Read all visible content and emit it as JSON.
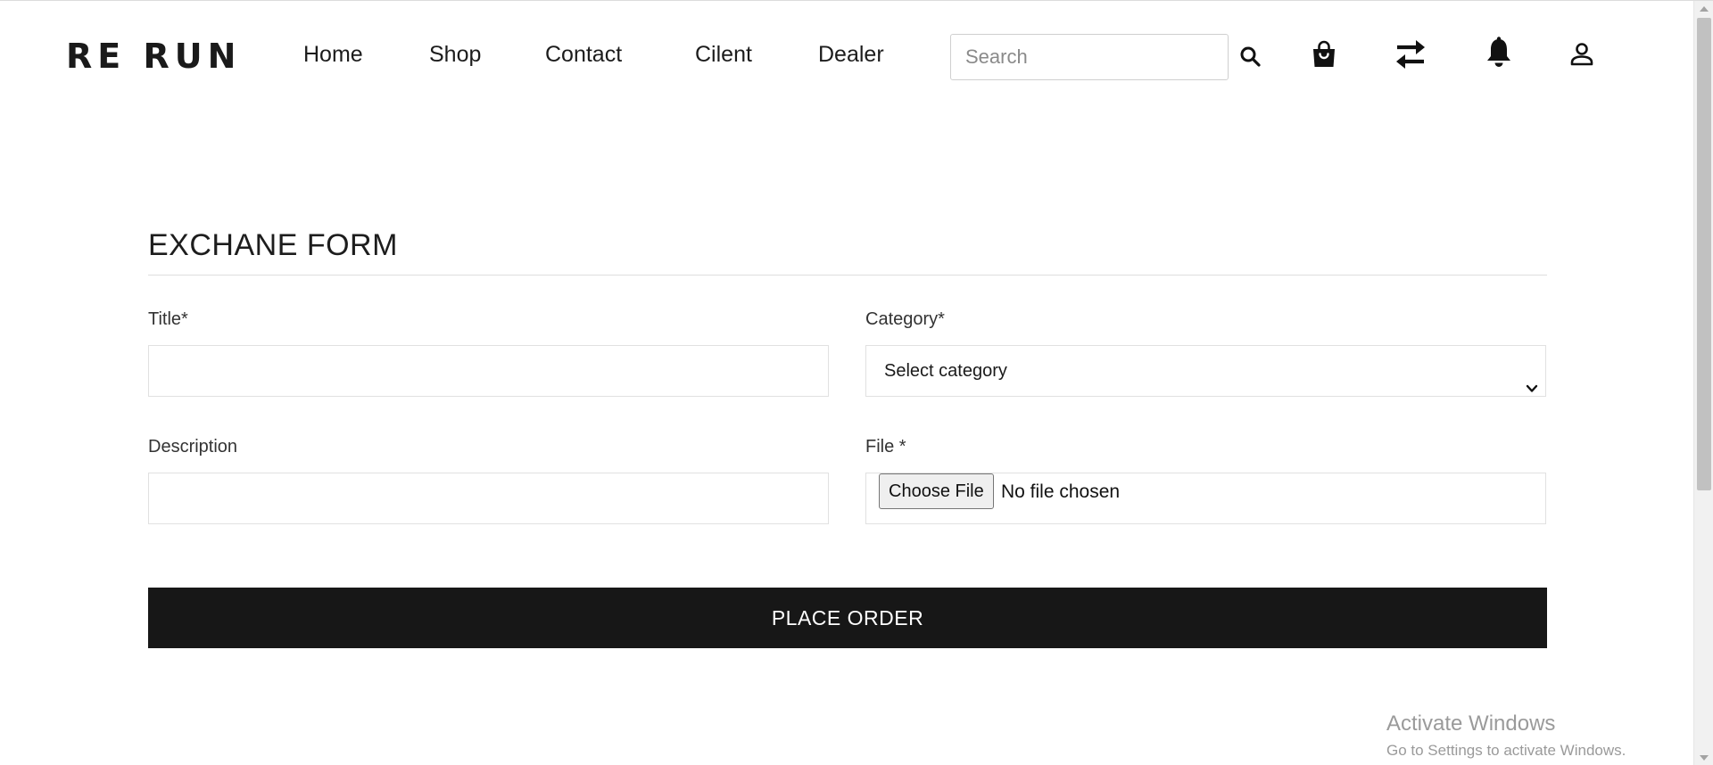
{
  "brand": {
    "logo_text": "RE RUN"
  },
  "nav": {
    "links": [
      "Home",
      "Shop",
      "Contact",
      "Cilent",
      "Dealer"
    ]
  },
  "search": {
    "placeholder": "Search",
    "value": ""
  },
  "header_icons": [
    "search-icon",
    "shopping-bag-icon",
    "exchange-arrows-icon",
    "bell-icon",
    "user-icon"
  ],
  "form": {
    "title": "EXCHANE FORM",
    "title_label": "Title*",
    "title_value": "",
    "category_label": "Category*",
    "category_selected": "Select category",
    "description_label": "Description",
    "description_value": "",
    "file_label": "File *",
    "file_button": "Choose File",
    "file_status": "No file chosen",
    "submit_label": "PLACE ORDER"
  },
  "watermark": {
    "title": "Activate Windows",
    "subtitle": "Go to Settings to activate Windows."
  },
  "colors": {
    "button_bg": "#171717",
    "button_text": "#ffffff",
    "border": "#e1e1e1",
    "text": "#222222"
  }
}
